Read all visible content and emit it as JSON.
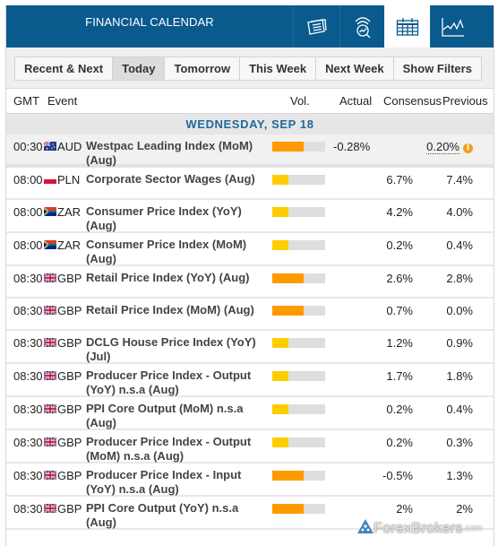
{
  "header": {
    "title": "FINANCIAL CALENDAR",
    "tabs": [
      {
        "icon": "newspaper-icon",
        "label": "News",
        "active": false
      },
      {
        "icon": "market-analysis-icon",
        "label": "Analysis",
        "active": false
      },
      {
        "icon": "calendar-icon",
        "label": "Calendar",
        "active": true
      },
      {
        "icon": "line-chart-icon",
        "label": "Chart",
        "active": false
      }
    ]
  },
  "filters": {
    "buttons": [
      {
        "label": "Recent & Next",
        "active": false
      },
      {
        "label": "Today",
        "active": true
      },
      {
        "label": "Tomorrow",
        "active": false
      },
      {
        "label": "This Week",
        "active": false
      },
      {
        "label": "Next Week",
        "active": false
      },
      {
        "label": "Show Filters",
        "active": false
      }
    ]
  },
  "columns": {
    "gmt": "GMT",
    "event": "Event",
    "vol": "Vol.",
    "actual": "Actual",
    "consensus": "Consensus",
    "previous": "Previous"
  },
  "day_label": "WEDNESDAY, SEP 18",
  "colors": {
    "header_bg": "#0a5a8e",
    "vol_high": "#ff9900",
    "vol_medium": "#ffcc00",
    "vol_track": "#dedede",
    "day_label": "#1f6a9b",
    "info": "#f0a01a"
  },
  "events": [
    {
      "time": "00:30",
      "flag": "australia-flag-icon",
      "currency": "AUD",
      "event": "Westpac Leading Index (MoM) (Aug)",
      "volatility": "high",
      "vol_level": 0.6,
      "actual": "-0.28%",
      "consensus": "",
      "previous": "0.20%",
      "previous_info": true,
      "highlight": true
    },
    {
      "time": "08:00",
      "flag": "poland-flag-icon",
      "currency": "PLN",
      "event": "Corporate Sector Wages (Aug)",
      "volatility": "medium",
      "vol_level": 0.3,
      "actual": "",
      "consensus": "6.7%",
      "previous": "7.4%"
    },
    {
      "time": "08:00",
      "flag": "south-africa-flag-icon",
      "currency": "ZAR",
      "event": "Consumer Price Index (YoY) (Aug)",
      "volatility": "medium",
      "vol_level": 0.3,
      "actual": "",
      "consensus": "4.2%",
      "previous": "4.0%"
    },
    {
      "time": "08:00",
      "flag": "south-africa-flag-icon",
      "currency": "ZAR",
      "event": "Consumer Price Index (MoM) (Aug)",
      "volatility": "medium",
      "vol_level": 0.3,
      "actual": "",
      "consensus": "0.2%",
      "previous": "0.4%"
    },
    {
      "time": "08:30",
      "flag": "uk-flag-icon",
      "currency": "GBP",
      "event": "Retail Price Index (YoY) (Aug)",
      "volatility": "high",
      "vol_level": 0.6,
      "actual": "",
      "consensus": "2.6%",
      "previous": "2.8%"
    },
    {
      "time": "08:30",
      "flag": "uk-flag-icon",
      "currency": "GBP",
      "event": "Retail Price Index (MoM) (Aug)",
      "volatility": "high",
      "vol_level": 0.6,
      "actual": "",
      "consensus": "0.7%",
      "previous": "0.0%"
    },
    {
      "time": "08:30",
      "flag": "uk-flag-icon",
      "currency": "GBP",
      "event": "DCLG House Price Index (YoY) (Jul)",
      "volatility": "medium",
      "vol_level": 0.3,
      "actual": "",
      "consensus": "1.2%",
      "previous": "0.9%"
    },
    {
      "time": "08:30",
      "flag": "uk-flag-icon",
      "currency": "GBP",
      "event": "Producer Price Index - Output (YoY) n.s.a (Aug)",
      "volatility": "medium",
      "vol_level": 0.3,
      "actual": "",
      "consensus": "1.7%",
      "previous": "1.8%"
    },
    {
      "time": "08:30",
      "flag": "uk-flag-icon",
      "currency": "GBP",
      "event": "PPI Core Output (MoM) n.s.a (Aug)",
      "volatility": "medium",
      "vol_level": 0.3,
      "actual": "",
      "consensus": "0.2%",
      "previous": "0.4%"
    },
    {
      "time": "08:30",
      "flag": "uk-flag-icon",
      "currency": "GBP",
      "event": "Producer Price Index - Output (MoM) n.s.a (Aug)",
      "volatility": "medium",
      "vol_level": 0.3,
      "actual": "",
      "consensus": "0.2%",
      "previous": "0.3%"
    },
    {
      "time": "08:30",
      "flag": "uk-flag-icon",
      "currency": "GBP",
      "event": "Producer Price Index - Input (YoY) n.s.a (Aug)",
      "volatility": "high",
      "vol_level": 0.6,
      "actual": "",
      "consensus": "-0.5%",
      "previous": "1.3%"
    },
    {
      "time": "08:30",
      "flag": "uk-flag-icon",
      "currency": "GBP",
      "event": "PPI Core Output (YoY) n.s.a (Aug)",
      "volatility": "high",
      "vol_level": 0.6,
      "actual": "",
      "consensus": "2%",
      "previous": "2%"
    }
  ],
  "watermark": {
    "brand": "ForexBrokers",
    "suffix": ".com"
  }
}
